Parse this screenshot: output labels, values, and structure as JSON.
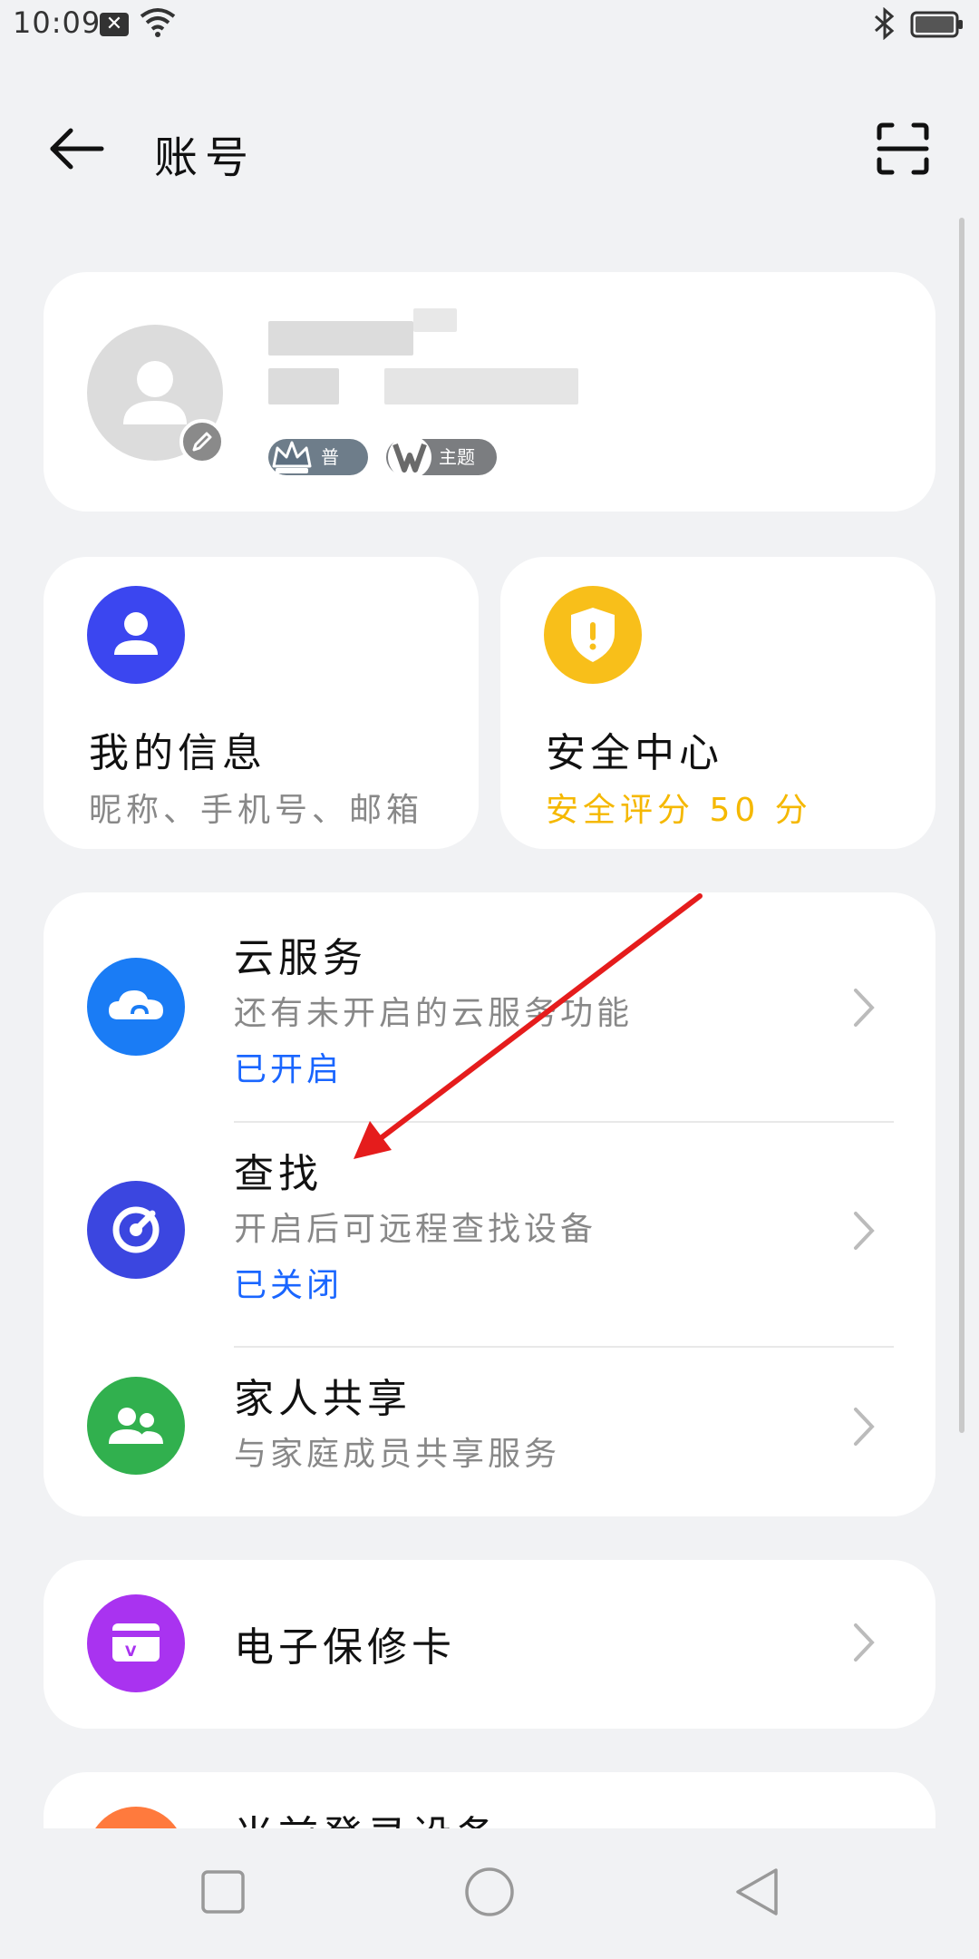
{
  "status_bar": {
    "time": "10:09"
  },
  "header": {
    "title": "账号"
  },
  "profile": {
    "badges": [
      {
        "label": "普卡",
        "icon": "crown-icon"
      },
      {
        "label": "主题",
        "icon": "theme-v-icon"
      }
    ]
  },
  "tiles": [
    {
      "title": "我的信息",
      "subtitle": "昵称、手机号、邮箱",
      "icon": "person-icon",
      "color": "#3b46f0"
    },
    {
      "title": "安全中心",
      "subtitle": "安全评分 50 分",
      "icon": "shield-icon",
      "color": "#f8bf1a"
    }
  ],
  "services": [
    {
      "title": "云服务",
      "subtitle": "还有未开启的云服务功能",
      "status": "已开启",
      "icon": "cloud-icon",
      "color": "#1a7cf5"
    },
    {
      "title": "查找",
      "subtitle": "开启后可远程查找设备",
      "status": "已关闭",
      "icon": "locate-icon",
      "color": "#3b46e0"
    },
    {
      "title": "家人共享",
      "subtitle": "与家庭成员共享服务",
      "icon": "family-icon",
      "color": "#31b04e"
    }
  ],
  "warranty": {
    "title": "电子保修卡",
    "icon": "card-icon",
    "color": "#a933f0"
  },
  "partial": {
    "title": "当前登录设备",
    "icon": "device-icon",
    "color": "#ff7a3d"
  },
  "annotation": {
    "arrow_color": "#e51c1c"
  }
}
